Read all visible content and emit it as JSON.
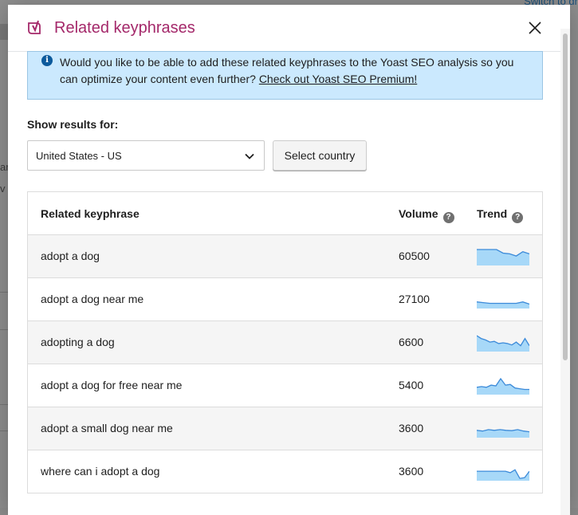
{
  "background": {
    "top_link": "Switch to dr",
    "side_text_1": "ar",
    "side_text_2": "v"
  },
  "modal": {
    "title": "Related keyphrases",
    "notice": {
      "text": "Would you like to be able to add these related keyphrases to the Yoast SEO analysis so you can optimize your content even further?",
      "link_text": "Check out Yoast SEO Premium!"
    },
    "show_results_label": "Show results for:",
    "country_select_value": "United States - US",
    "select_country_button": "Select country",
    "table": {
      "headers": {
        "keyphrase": "Related keyphrase",
        "volume": "Volume",
        "trend": "Trend"
      },
      "help_icon_glyph": "?",
      "rows": [
        {
          "keyphrase": "adopt a dog",
          "volume": "60500",
          "trend": [
            1,
            1,
            1,
            1,
            0.75,
            0.7,
            0.55,
            0.85,
            0.7
          ]
        },
        {
          "keyphrase": "adopt a dog near me",
          "volume": "27100",
          "trend": [
            0.35,
            0.3,
            0.25,
            0.25,
            0.25,
            0.25,
            0.25,
            0.35,
            0.2
          ]
        },
        {
          "keyphrase": "adopting a dog",
          "volume": "6600",
          "trend": [
            1,
            0.8,
            0.7,
            0.55,
            0.6,
            0.45,
            0.5,
            0.45,
            0.35,
            0.55,
            0.3,
            0.8,
            0.3
          ]
        },
        {
          "keyphrase": "adopt a dog for free near me",
          "volume": "5400",
          "trend": [
            0.4,
            0.45,
            0.4,
            0.55,
            0.5,
            1,
            0.55,
            0.6,
            0.35,
            0.3,
            0.25,
            0.25
          ]
        },
        {
          "keyphrase": "adopt a small dog near me",
          "volume": "3600",
          "trend": [
            0.4,
            0.35,
            0.45,
            0.4,
            0.45,
            0.4,
            0.38,
            0.45,
            0.35,
            0.3
          ]
        },
        {
          "keyphrase": "where can i adopt a dog",
          "volume": "3600",
          "trend": [
            0.55,
            0.55,
            0.55,
            0.55,
            0.55,
            0.55,
            0.55,
            0.45,
            0.65,
            0.05,
            0.1,
            0.55
          ]
        }
      ]
    }
  },
  "colors": {
    "title": "#a4286a",
    "notice_bg": "#cbe9fe",
    "trend_line": "#3b8ad9",
    "trend_fill": "#a7d8f8"
  }
}
